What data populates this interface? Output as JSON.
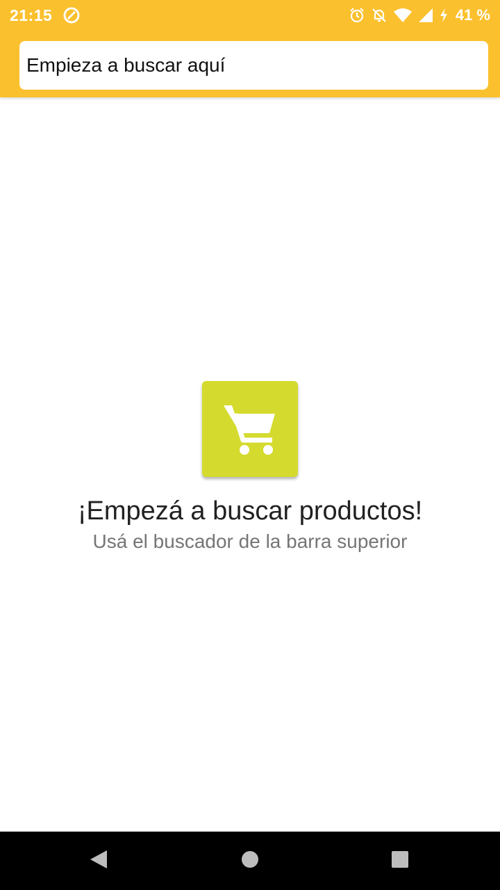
{
  "status_bar": {
    "time": "21:15",
    "battery": "41 %",
    "icons": [
      "data-saver-icon",
      "alarm-icon",
      "notifications-off-icon",
      "wifi-icon",
      "signal-icon",
      "charging-icon"
    ]
  },
  "search": {
    "placeholder": "Empieza a buscar aquí"
  },
  "empty_state": {
    "icon": "shopping-cart-icon",
    "title": "¡Empezá a buscar productos!",
    "subtitle": "Usá el buscador de la barra superior"
  },
  "colors": {
    "app_bar": "#FBC02D",
    "cart_tile": "#D4DB2E",
    "nav_bar": "#000000"
  },
  "nav_bar": {
    "buttons": [
      "back-icon",
      "home-icon",
      "recents-icon"
    ]
  }
}
